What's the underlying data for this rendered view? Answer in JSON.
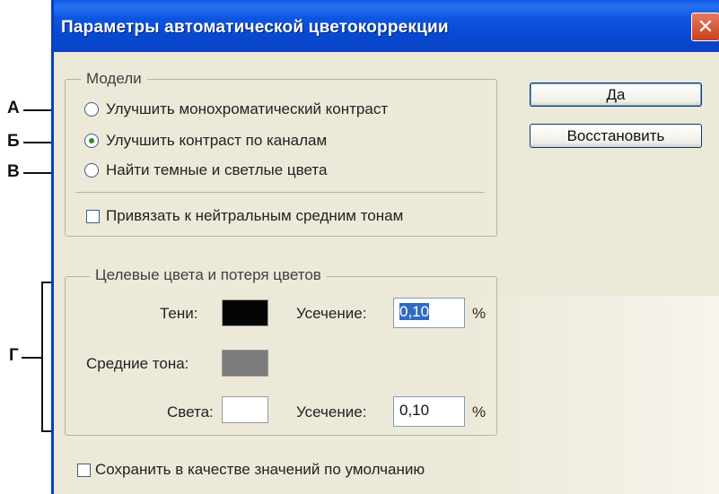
{
  "dialog": {
    "title": "Параметры автоматической цветокоррекции",
    "close_glyph": "✕"
  },
  "callouts": {
    "a": "А",
    "b": "Б",
    "v": "В",
    "g": "Г"
  },
  "algorithms": {
    "legend": "Модели",
    "options": [
      {
        "label": "Улучшить монохроматический контраст",
        "selected": false
      },
      {
        "label": "Улучшить контраст по каналам",
        "selected": true
      },
      {
        "label": "Найти темные и светлые цвета",
        "selected": false
      }
    ],
    "snap_label": "Привязать к нейтральным средним тонам",
    "snap_checked": false
  },
  "buttons": {
    "ok": "Да",
    "reset": "Восстановить"
  },
  "targets": {
    "legend": "Целевые цвета и потеря цветов",
    "shadows_label": "Тени:",
    "midtones_label": "Средние тона:",
    "highlights_label": "Света:",
    "clip_label": "Усечение:",
    "shadows_clip": "0,10",
    "highlights_clip": "0,10",
    "percent": "%",
    "shadows_color": "#050505",
    "midtones_color": "#7c7c7c",
    "highlights_color": "#ffffff"
  },
  "save_defaults": {
    "label": "Сохранить в качестве значений по умолчанию",
    "checked": false
  }
}
